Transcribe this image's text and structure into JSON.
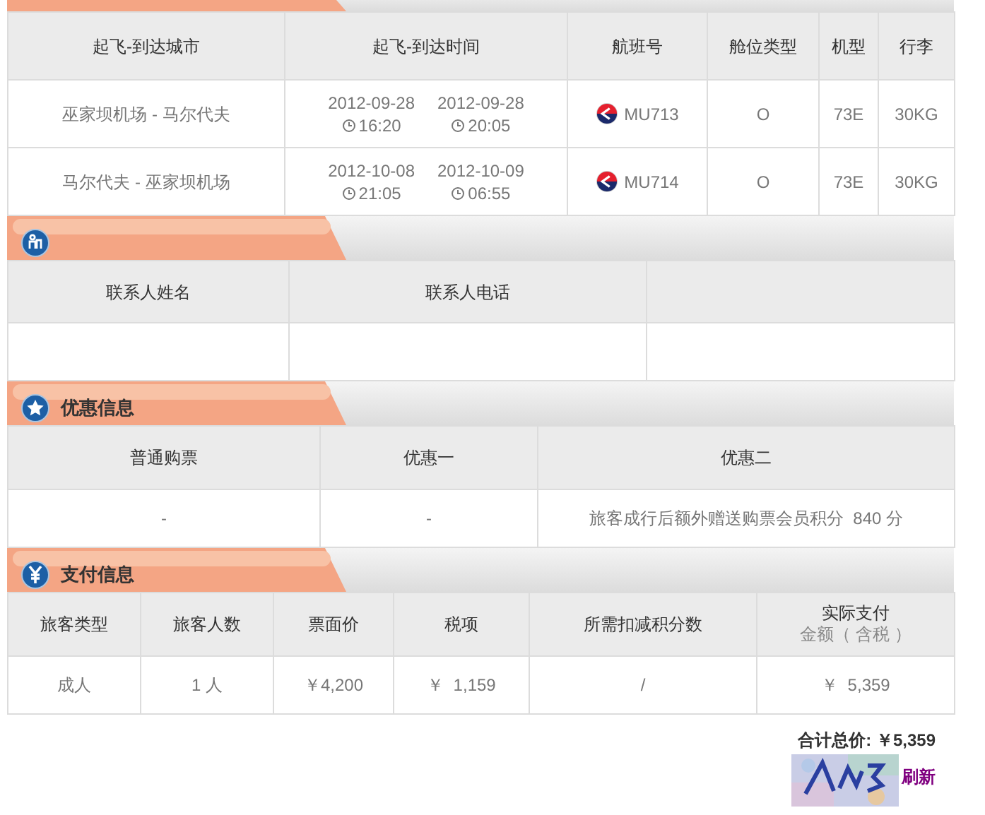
{
  "flights": {
    "columns": [
      "起飞-到达城市",
      "起飞-到达时间",
      "航班号",
      "舱位类型",
      "机型",
      "行李"
    ],
    "rows": [
      {
        "route": "巫家坝机场 - 马尔代夫",
        "departure": {
          "date": "2012-09-28",
          "time": "16:20"
        },
        "arrival": {
          "date": "2012-09-28",
          "time": "20:05"
        },
        "flight": "MU713",
        "cabin": "O",
        "aircraft": "73E",
        "baggage": "30KG"
      },
      {
        "route": "马尔代夫 - 巫家坝机场",
        "departure": {
          "date": "2012-10-08",
          "time": "21:05"
        },
        "arrival": {
          "date": "2012-10-09",
          "time": "06:55"
        },
        "flight": "MU714",
        "cabin": "O",
        "aircraft": "73E",
        "baggage": "30KG"
      }
    ]
  },
  "contact": {
    "columns": [
      "联系人姓名",
      "联系人电话"
    ],
    "rows": [
      [
        "",
        ""
      ]
    ]
  },
  "discount": {
    "title": "优惠信息",
    "columns": [
      "普通购票",
      "优惠一",
      "优惠二"
    ],
    "rows": [
      [
        "-",
        "-",
        "旅客成行后额外赠送购票会员积分  840 分"
      ]
    ]
  },
  "payment": {
    "title": "支付信息",
    "columns": [
      {
        "label": "旅客类型"
      },
      {
        "label": "旅客人数"
      },
      {
        "label": "票面价"
      },
      {
        "label": "税项"
      },
      {
        "label": "所需扣减积分数"
      },
      {
        "label": "实际支付",
        "sublabel": "金额（ 含税 ）"
      }
    ],
    "rows": [
      [
        "成人",
        "1 人",
        "￥4,200",
        "￥  1,159",
        "/",
        "￥  5,359"
      ]
    ]
  },
  "total": "合计总价: ￥5,359",
  "refresh_link": "刷新"
}
